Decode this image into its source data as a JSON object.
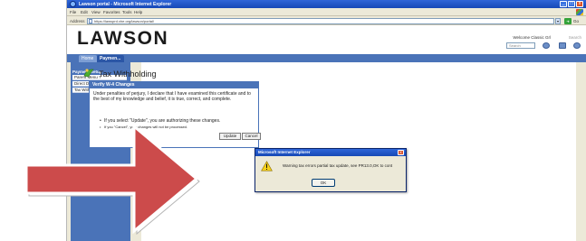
{
  "window": {
    "title": "Lawson portal - Microsoft Internet Explorer",
    "buttons": [
      "_",
      "□",
      "x"
    ]
  },
  "menubar": {
    "items": [
      "File",
      "Edit",
      "View",
      "Favorites",
      "Tools",
      "Help"
    ]
  },
  "addressbar": {
    "label": "Address",
    "url": "https://lawsprd.xhe.org/lawson/portal/",
    "go_label": "Go"
  },
  "header": {
    "logo": "LAWSON",
    "welcome": "Welcome Classic Grl",
    "welcome_sub": "Search",
    "search_placeholder": "Search"
  },
  "tabs": [
    "Home",
    "Paymen..."
  ],
  "sidebar": {
    "heading": "Payment Setup",
    "items": [
      "Parent Menu ?",
      "Direct Deposit",
      "Tax Withholding"
    ]
  },
  "page": {
    "title": "Tax Withholding"
  },
  "verify_panel": {
    "heading": "Verify W-4 Changes",
    "body": "Under penalties of perjury, I declare that I have examined this certificate and to the best of my knowledge and belief, it is true, correct, and complete.",
    "bullet1": "If you select \"Update\", you are authorizing these changes.",
    "bullet2": "If you \"Cancel\", your changes will not be processed.",
    "update_label": "Update",
    "cancel_label": "Cancel"
  },
  "dialog": {
    "title": "Microsoft Internet Explorer",
    "close": "x",
    "message": "Warning tax errors partial tax update, see PR13.0,OK to cont",
    "ok_label": "OK"
  },
  "colors": {
    "xp_blue": "#1648b6",
    "lawson_blue": "#4a73b8",
    "arrow_red": "#cc4b4b"
  }
}
